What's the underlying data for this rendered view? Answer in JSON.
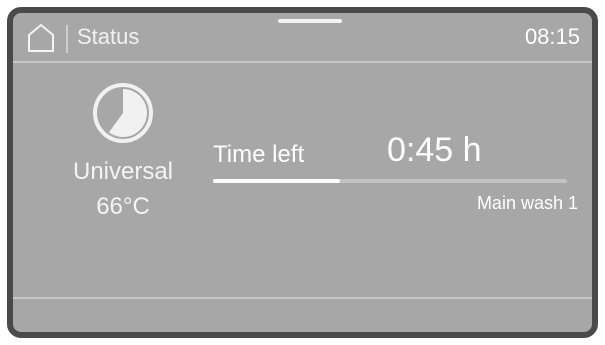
{
  "header": {
    "home_icon": "home-icon",
    "title": "Status",
    "clock": "08:15"
  },
  "program": {
    "icon": "program-progress-pie-icon",
    "name": "Universal",
    "temperature": "66°C",
    "progress_pie_fraction": 0.6
  },
  "timer": {
    "label": "Time left",
    "value": "0:45 h",
    "progress_fraction": 0.36,
    "phase": "Main wash 1"
  },
  "colors": {
    "screen_bg": "#a7a7a7",
    "frame": "#4a4a4a",
    "text": "#ffffff",
    "progress_track": "#c3c3c3",
    "progress_fill": "#ffffff"
  }
}
